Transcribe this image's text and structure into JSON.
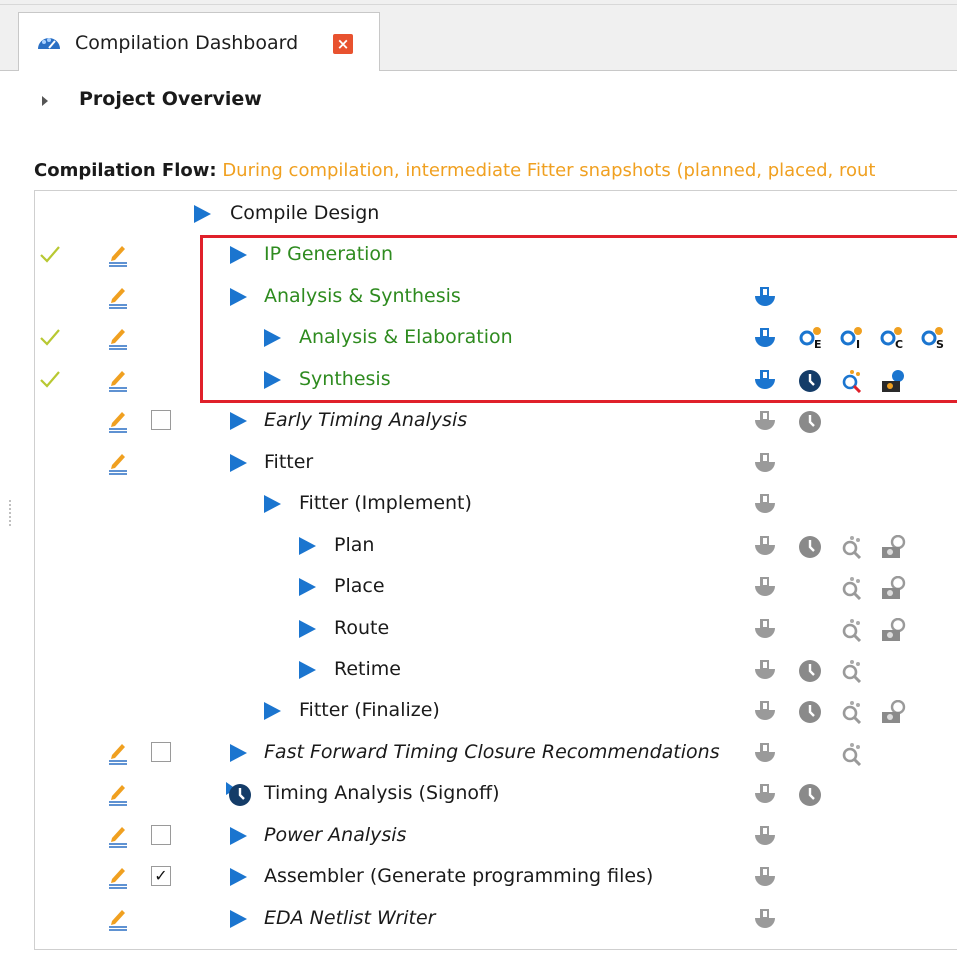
{
  "tab": {
    "label": "Compilation Dashboard",
    "icon": "speedometer-icon",
    "close_icon": "close-icon"
  },
  "project_overview": {
    "label": "Project Overview"
  },
  "compilation_flow": {
    "label": "Compilation Flow",
    "colon": ":",
    "message": " During compilation, intermediate Fitter snapshots (planned, placed, rout"
  },
  "colors": {
    "green_task": "#2e8b1f",
    "blue_triangle": "#1b75cf",
    "highlight_box": "#e0202a",
    "message_orange": "#f0a020"
  },
  "tasks": [
    {
      "label": "Compile Design",
      "style": "normal"
    },
    {
      "label": "IP Generation",
      "style": "green",
      "status": "completed"
    },
    {
      "label": "Analysis & Synthesis",
      "style": "green"
    },
    {
      "label": "Analysis & Elaboration",
      "style": "green",
      "status": "completed"
    },
    {
      "label": "Synthesis",
      "style": "green",
      "status": "completed"
    },
    {
      "label": "Early Timing Analysis",
      "style": "italic",
      "checkbox": false
    },
    {
      "label": "Fitter",
      "style": "normal"
    },
    {
      "label": "Fitter (Implement)",
      "style": "normal"
    },
    {
      "label": "Plan",
      "style": "normal"
    },
    {
      "label": "Place",
      "style": "normal"
    },
    {
      "label": "Route",
      "style": "normal"
    },
    {
      "label": "Retime",
      "style": "normal"
    },
    {
      "label": "Fitter (Finalize)",
      "style": "normal"
    },
    {
      "label": "Fast Forward Timing Closure Recommendations",
      "style": "italic",
      "checkbox": false
    },
    {
      "label": "Timing Analysis (Signoff)",
      "style": "normal"
    },
    {
      "label": "Power Analysis",
      "style": "italic",
      "checkbox": false
    },
    {
      "label": "Assembler (Generate programming files)",
      "style": "normal",
      "checkbox": true
    },
    {
      "label": "EDA Netlist Writer",
      "style": "italic"
    }
  ],
  "report_icon_letters": {
    "elaboration": [
      "E",
      "I",
      "C",
      "S"
    ]
  },
  "checkbox_checked_glyph": "✓"
}
